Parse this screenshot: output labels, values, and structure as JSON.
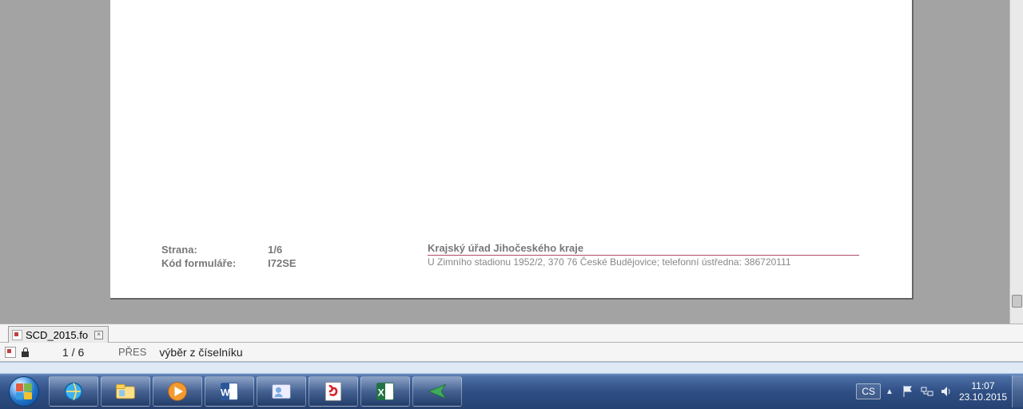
{
  "document": {
    "footer": {
      "page_label": "Strana:",
      "page_value": "1/6",
      "form_code_label": "Kód formuláře:",
      "form_code_value": "I72SE",
      "org_name": "Krajský úřad Jihočeského kraje",
      "org_address": "U Zimního stadionu 1952/2, 370 76 České Budějovice; telefonní ústředna: 386720111"
    }
  },
  "tab": {
    "filename": "SCD_2015.fo"
  },
  "status": {
    "page_counter": "1 / 6",
    "mode": "PŘES",
    "field_desc": "výběr z číselníku"
  },
  "tray": {
    "lang": "CS",
    "time": "11:07",
    "date": "23.10.2015"
  }
}
